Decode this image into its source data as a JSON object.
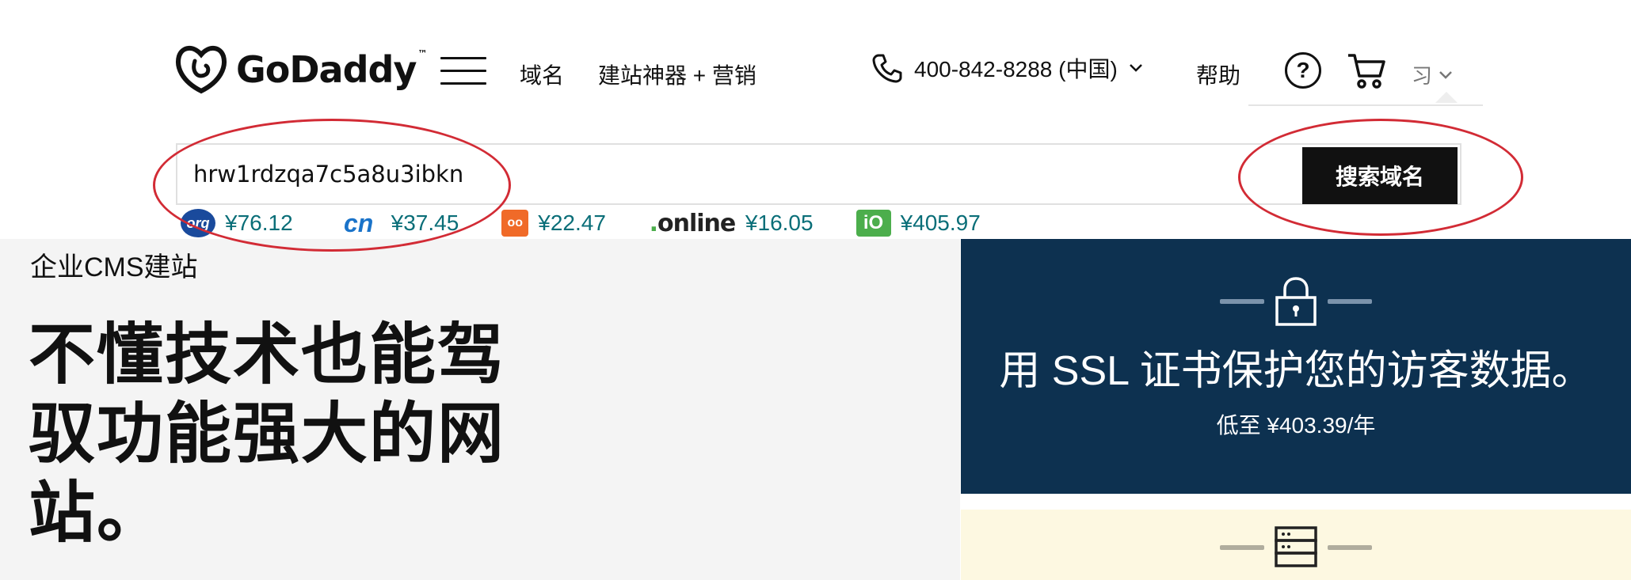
{
  "header": {
    "logo_text": "GoDaddy",
    "logo_tm": "™",
    "nav": {
      "domains": "域名",
      "builder": "建站神器 + 营销"
    },
    "phone": "400-842-8288 (中国)",
    "help": "帮助",
    "help_glyph": "?",
    "user_initials": "习"
  },
  "search": {
    "value": "hrw1rdzqa7c5a8u3ibkn",
    "button_label": "搜索域名"
  },
  "tlds": [
    {
      "name": ".org",
      "logo_text": "org",
      "price": "¥76.12"
    },
    {
      "name": ".cn",
      "logo_text": "cn",
      "price": "¥37.45"
    },
    {
      "name": ".oo",
      "logo_text": "oo",
      "price": "¥22.47"
    },
    {
      "name": ".online",
      "logo_text": "online",
      "price": "¥16.05"
    },
    {
      "name": ".io",
      "logo_text": "iO",
      "price": "¥405.97"
    }
  ],
  "left": {
    "section_label": "企业CMS建站",
    "hero_title": "不懂技术也能驾驭功能强大的网站。"
  },
  "ssl": {
    "title": "用 SSL 证书保护您的访客数据。",
    "price": "低至 ¥403.39/年"
  },
  "colors": {
    "accent_dark": "#0d3150",
    "price_teal": "#0a6e78",
    "annotation_red": "#d22b35",
    "button_black": "#111111",
    "yellow_card": "#fdf8e1"
  },
  "icons": [
    "godaddy-logo-icon",
    "menu-icon",
    "phone-icon",
    "chevron-down-icon",
    "help-icon",
    "cart-icon",
    "lock-icon",
    "server-icon"
  ]
}
